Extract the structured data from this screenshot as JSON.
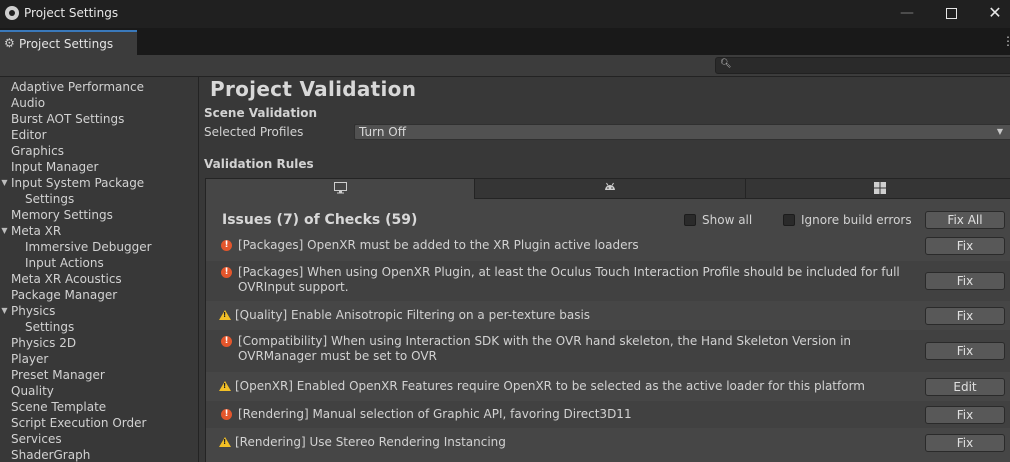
{
  "window": {
    "title": "Project Settings"
  },
  "tab": {
    "label": "Project Settings"
  },
  "sidebar": {
    "items": [
      {
        "label": "Adaptive Performance",
        "level": 0
      },
      {
        "label": "Audio",
        "level": 0
      },
      {
        "label": "Burst AOT Settings",
        "level": 0
      },
      {
        "label": "Editor",
        "level": 0
      },
      {
        "label": "Graphics",
        "level": 0
      },
      {
        "label": "Input Manager",
        "level": 0
      },
      {
        "label": "Input System Package",
        "level": 0,
        "expanded": true
      },
      {
        "label": "Settings",
        "level": 1
      },
      {
        "label": "Memory Settings",
        "level": 0
      },
      {
        "label": "Meta XR",
        "level": 0,
        "expanded": true
      },
      {
        "label": "Immersive Debugger",
        "level": 1
      },
      {
        "label": "Input Actions",
        "level": 1
      },
      {
        "label": "Meta XR Acoustics",
        "level": 0
      },
      {
        "label": "Package Manager",
        "level": 0
      },
      {
        "label": "Physics",
        "level": 0,
        "expanded": true
      },
      {
        "label": "Settings",
        "level": 1
      },
      {
        "label": "Physics 2D",
        "level": 0
      },
      {
        "label": "Player",
        "level": 0
      },
      {
        "label": "Preset Manager",
        "level": 0
      },
      {
        "label": "Quality",
        "level": 0
      },
      {
        "label": "Scene Template",
        "level": 0
      },
      {
        "label": "Script Execution Order",
        "level": 0
      },
      {
        "label": "Services",
        "level": 0
      },
      {
        "label": "ShaderGraph",
        "level": 0
      }
    ]
  },
  "main": {
    "title": "Project Validation",
    "scene_validation": "Scene Validation",
    "selected_profiles_label": "Selected Profiles",
    "selected_profiles_value": "Turn Off",
    "validation_rules": "Validation Rules",
    "platform_tabs": [
      "monitor-icon",
      "android-icon",
      "windows-icon"
    ],
    "issues_title": "Issues (7) of Checks (59)",
    "show_all_label": "Show all",
    "ignore_build_errors_label": "Ignore build errors",
    "fix_all_label": "Fix All",
    "rules": [
      {
        "severity": "error",
        "text": "[Packages] OpenXR must be added to the XR Plugin active loaders",
        "action": "Fix"
      },
      {
        "severity": "error",
        "text": "[Packages] When using OpenXR Plugin, at least the Oculus Touch Interaction Profile should be included for full OVRInput support.",
        "action": "Fix"
      },
      {
        "severity": "warning",
        "text": "[Quality] Enable Anisotropic Filtering on a per-texture basis",
        "action": "Fix"
      },
      {
        "severity": "error",
        "text": "[Compatibility] When using Interaction SDK with the OVR hand skeleton, the Hand Skeleton Version in OVRManager must be set to OVR",
        "action": "Fix"
      },
      {
        "severity": "warning",
        "text": "[OpenXR] Enabled OpenXR Features require OpenXR to be selected as the active loader for this platform",
        "action": "Edit"
      },
      {
        "severity": "error",
        "text": "[Rendering] Manual selection of Graphic API, favoring Direct3D11",
        "action": "Fix"
      },
      {
        "severity": "warning",
        "text": "[Rendering] Use Stereo Rendering Instancing",
        "action": "Fix"
      }
    ]
  }
}
